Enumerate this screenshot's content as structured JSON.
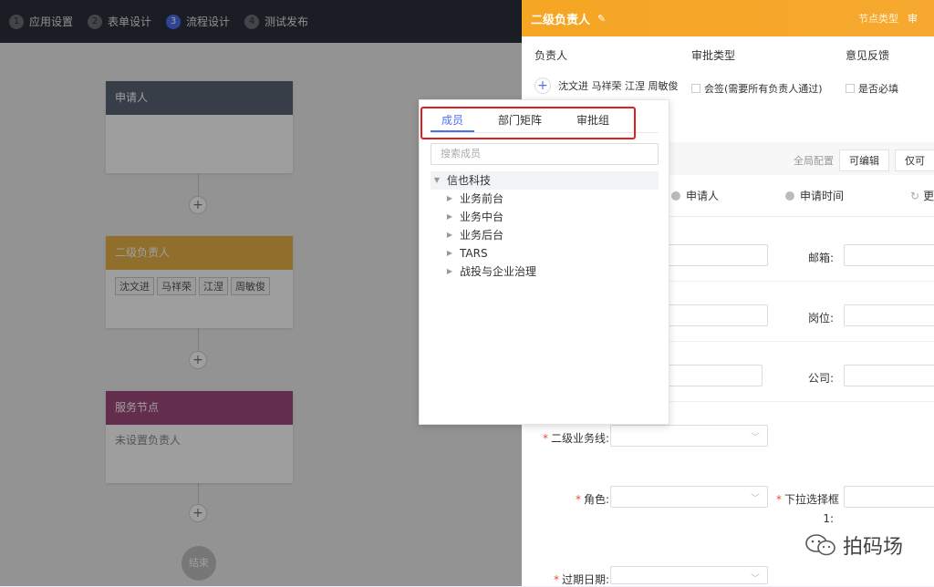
{
  "steps": [
    {
      "num": "1",
      "label": "应用设置"
    },
    {
      "num": "2",
      "label": "表单设计"
    },
    {
      "num": "3",
      "label": "流程设计"
    },
    {
      "num": "4",
      "label": "测试发布"
    }
  ],
  "flow": {
    "applicant_title": "申请人",
    "level2_title": "二级负责人",
    "level2_tags": [
      "沈文进",
      "马祥荣",
      "江涅",
      "周敏俊"
    ],
    "service_title": "服务节点",
    "service_body": "未设置负责人",
    "plus": "+",
    "end_label": "结束"
  },
  "drawer": {
    "title": "二级负责人",
    "edit_icon": "✎",
    "node_type_label": "节点类型",
    "node_type_value": "审",
    "owner_label": "负责人",
    "owner_names": "沈文进 马祥荣 江涅 周敏俊",
    "approval_label": "审批类型",
    "approval_option": "会签(需要所有负责人通过)",
    "feedback_label": "意见反馈",
    "feedback_option": "是否必填",
    "global_cfg": "全局配置",
    "editable_btn": "可编辑",
    "readonly_btn": "仅可",
    "info_applicant": "申请人",
    "info_time": "申请时间",
    "info_more": "更",
    "email_label": "邮箱:",
    "post_label": "岗位:",
    "company_label": "公司:",
    "biz_line_label": "二级业务线:",
    "role_label": "角色:",
    "dropdown_label": "下拉选择框",
    "dropdown_suffix": "1:",
    "expire_label": "过期日期:",
    "required_mark": "*"
  },
  "popover": {
    "tabs": [
      "成员",
      "部门矩阵",
      "审批组"
    ],
    "search_placeholder": "搜索成员",
    "root": "信也科技",
    "children": [
      "业务前台",
      "业务中台",
      "业务后台",
      "TARS",
      "战投与企业治理"
    ]
  },
  "watermark": "拍码场",
  "colors": {
    "accent": "#4e6ef2",
    "drawer_header": "#f5a623",
    "applicant_header": "#5b6475",
    "level2_header": "#e8b34a",
    "service_header": "#a14a7f",
    "highlight": "#e02020"
  }
}
